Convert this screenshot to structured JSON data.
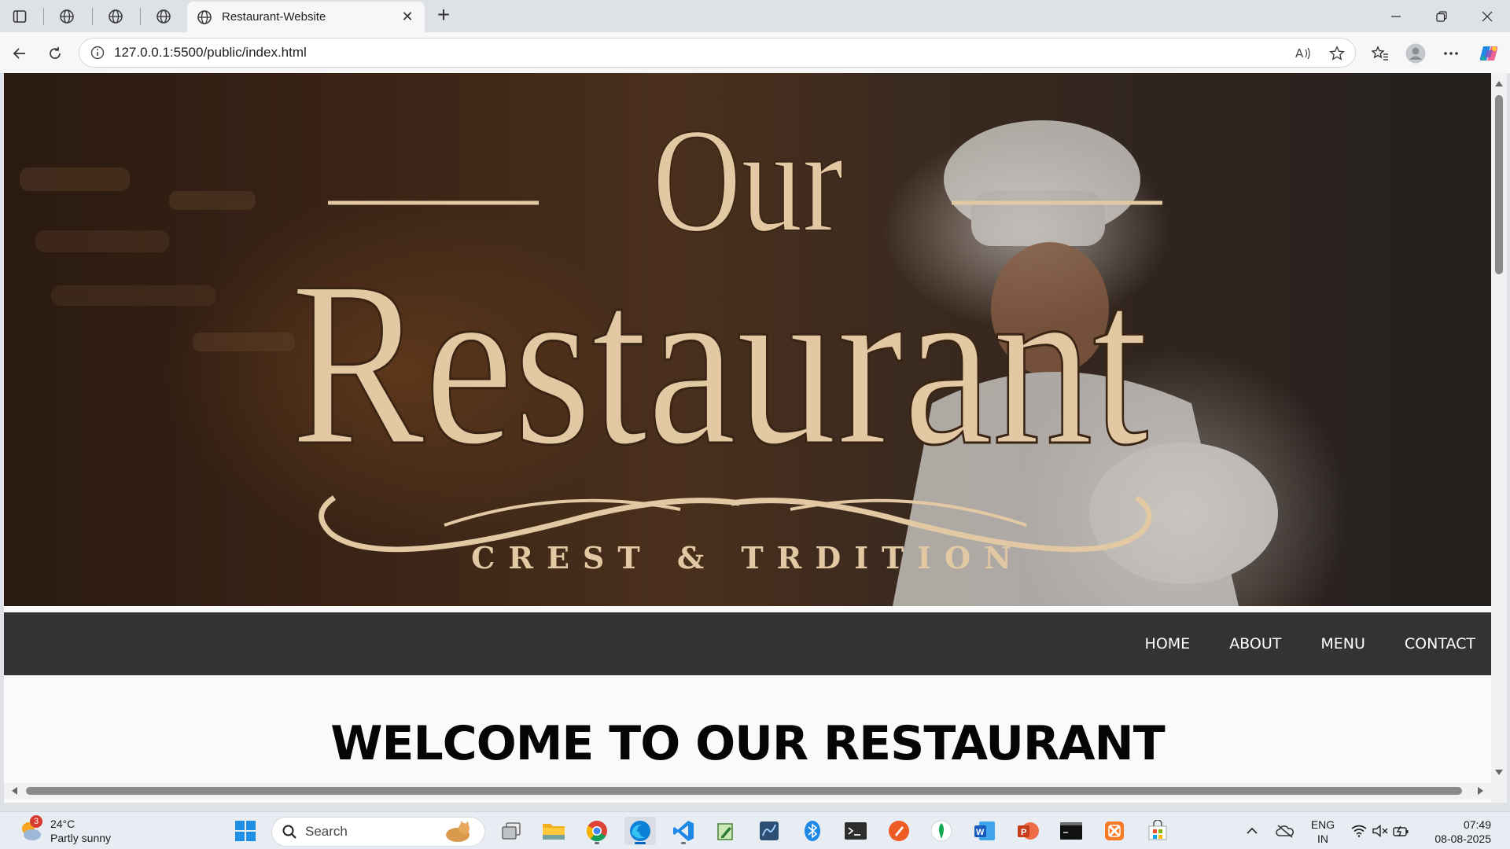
{
  "browser": {
    "active_tab_title": "Restaurant-Website",
    "url": "127.0.0.1:5500/public/index.html"
  },
  "hero": {
    "line1": "Our",
    "line2": "Restaurant",
    "tagline": "CREST & TRDITION"
  },
  "site_nav": {
    "items": [
      "HOME",
      "ABOUT",
      "MENU",
      "CONTACT"
    ]
  },
  "main": {
    "heading": "WELCOME TO OUR RESTAURANT"
  },
  "taskbar": {
    "weather_temp": "24°C",
    "weather_desc": "Partly sunny",
    "weather_badge": "3",
    "search_placeholder": "Search",
    "lang_line1": "ENG",
    "lang_line2": "IN",
    "time": "07:49",
    "date": "08-08-2025"
  },
  "colors": {
    "nav_bg": "#333333",
    "hero_text": "#e2c9a4",
    "tab_bg": "#dee1e6"
  }
}
